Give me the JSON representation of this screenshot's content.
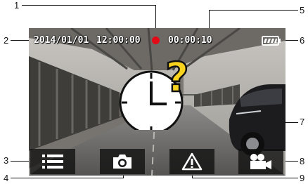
{
  "osd": {
    "date": "2014/01/01",
    "time": "12:00:00",
    "rec_elapsed": "00:00:10",
    "rec_indicator_color": "#e30b17"
  },
  "buttons": [
    {
      "icon": "menu-icon"
    },
    {
      "icon": "camera-icon"
    },
    {
      "icon": "warning-triangle-icon"
    },
    {
      "icon": "video-camera-icon"
    }
  ],
  "overlay": {
    "icon": "clock-question-icon",
    "accent": "#f7d21e"
  },
  "battery": {
    "icon": "battery-icon"
  },
  "callouts": [
    "1",
    "2",
    "3",
    "4",
    "5",
    "6",
    "7",
    "8",
    "9"
  ]
}
